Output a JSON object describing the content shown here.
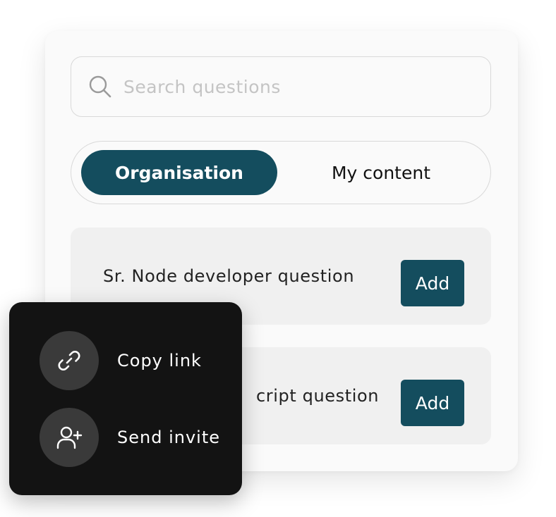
{
  "search": {
    "placeholder": "Search questions",
    "icon": "search-icon"
  },
  "tabs": [
    {
      "label": "Organisation",
      "active": true
    },
    {
      "label": "My content",
      "active": false
    }
  ],
  "questions": [
    {
      "title": "Sr. Node developer question",
      "action_label": "Add"
    },
    {
      "title": "cript question",
      "action_label": "Add"
    }
  ],
  "share_menu": {
    "items": [
      {
        "label": "Copy link",
        "icon": "link-icon"
      },
      {
        "label": "Send invite",
        "icon": "add-user-icon"
      }
    ]
  },
  "colors": {
    "accent": "#144d5e",
    "card_bg": "#fafafa",
    "row_bg": "#f0f0f0",
    "popup_bg": "#131313",
    "icon_circle": "#3a3a3a"
  }
}
